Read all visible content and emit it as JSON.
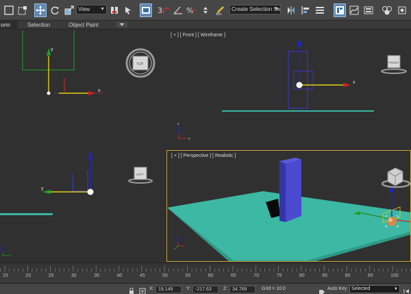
{
  "toolbar": {
    "view_dropdown": "View",
    "selection_set_dropdown": "Create Selection Se",
    "snap_label": "3",
    "percent_label": "%"
  },
  "ribbon": {
    "tabs": [
      {
        "label": "orm",
        "active": true
      },
      {
        "label": "Selection",
        "active": false
      },
      {
        "label": "Object Paint",
        "active": false
      }
    ]
  },
  "viewports": {
    "top": {
      "viewcube_label": "TOP"
    },
    "front": {
      "label": "[ + ] [ Front ] [ Wireframe ]",
      "viewcube_label": "FRONT"
    },
    "left": {
      "viewcube_label": "LEFT"
    },
    "perspective": {
      "label": "[ + ] [ Perspective ] [ Realistic ]"
    }
  },
  "trackbar": {
    "ticks": [
      "15",
      "20",
      "25",
      "30",
      "35",
      "40",
      "45",
      "50",
      "55",
      "60",
      "65",
      "70",
      "75",
      "80",
      "85",
      "90",
      "95",
      "100"
    ]
  },
  "statusbar": {
    "x_label": "X:",
    "x_value": "19.149",
    "y_label": "Y:",
    "y_value": "-217.63",
    "z_label": "Z:",
    "z_value": "34.769",
    "grid": "Grid = 10.0",
    "auto_key": "Auto Key",
    "selected": "Selected"
  },
  "colors": {
    "viewport_bg": "#303030",
    "active_border": "#c9a43a",
    "plane": "#3cb8a4",
    "box": "#4747c6",
    "gizmo_x": "#cc2222",
    "gizmo_y": "#22a022",
    "gizmo_z": "#2230cc"
  }
}
